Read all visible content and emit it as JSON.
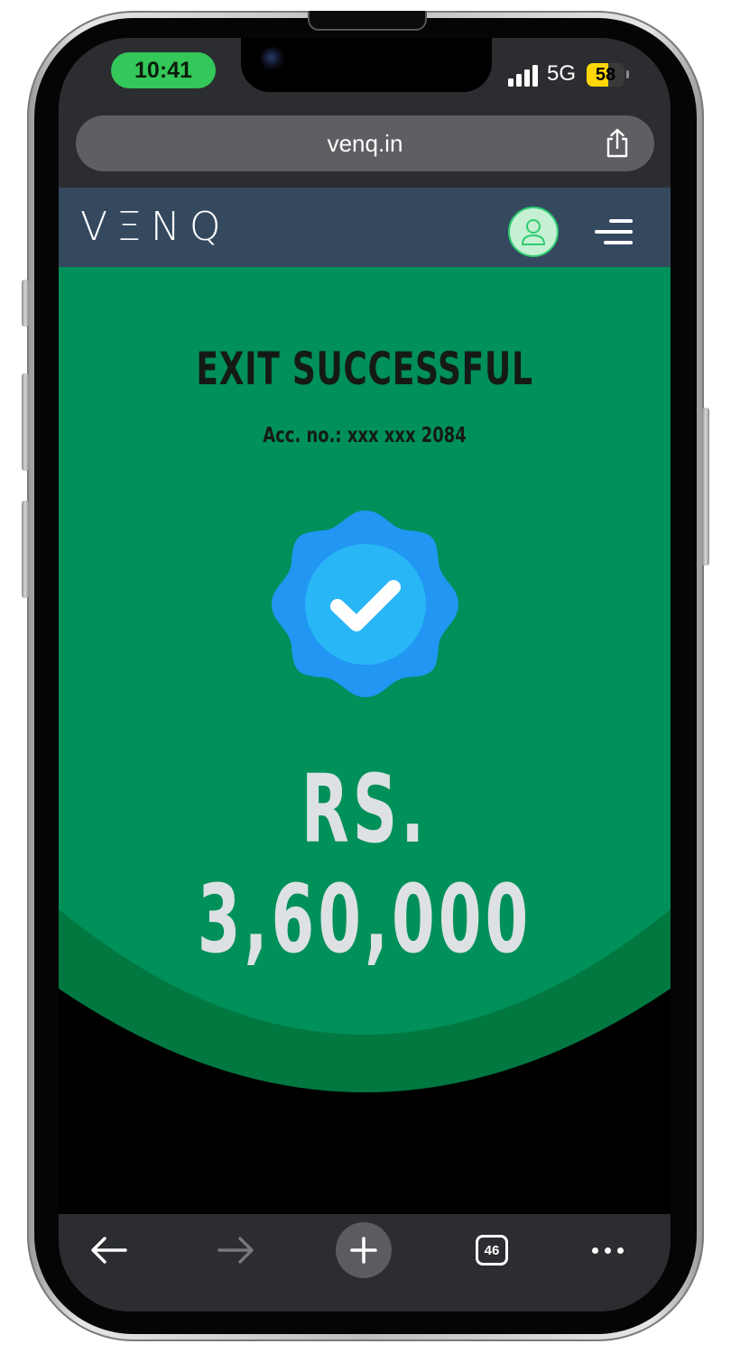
{
  "status_bar": {
    "time": "10:41",
    "network": "5G",
    "battery": "58",
    "battery_level": 0.58
  },
  "browser": {
    "url": "venq.in"
  },
  "app": {
    "logo": "VΞNQ"
  },
  "hero": {
    "title": "EXIT SUCCESSFUL",
    "account": "Acc. no.: xxx xxx 2084",
    "amount": "RS. 3,60,000"
  },
  "toolbar": {
    "tabs_count": "46"
  },
  "colors": {
    "header": "#34495e",
    "hero_green": "#00905a",
    "hero_dark_green": "#007840",
    "badge_outer": "#2196f3",
    "badge_inner": "#29b6f6",
    "status_pill": "#34c759",
    "battery_yellow": "#ffd60a"
  }
}
